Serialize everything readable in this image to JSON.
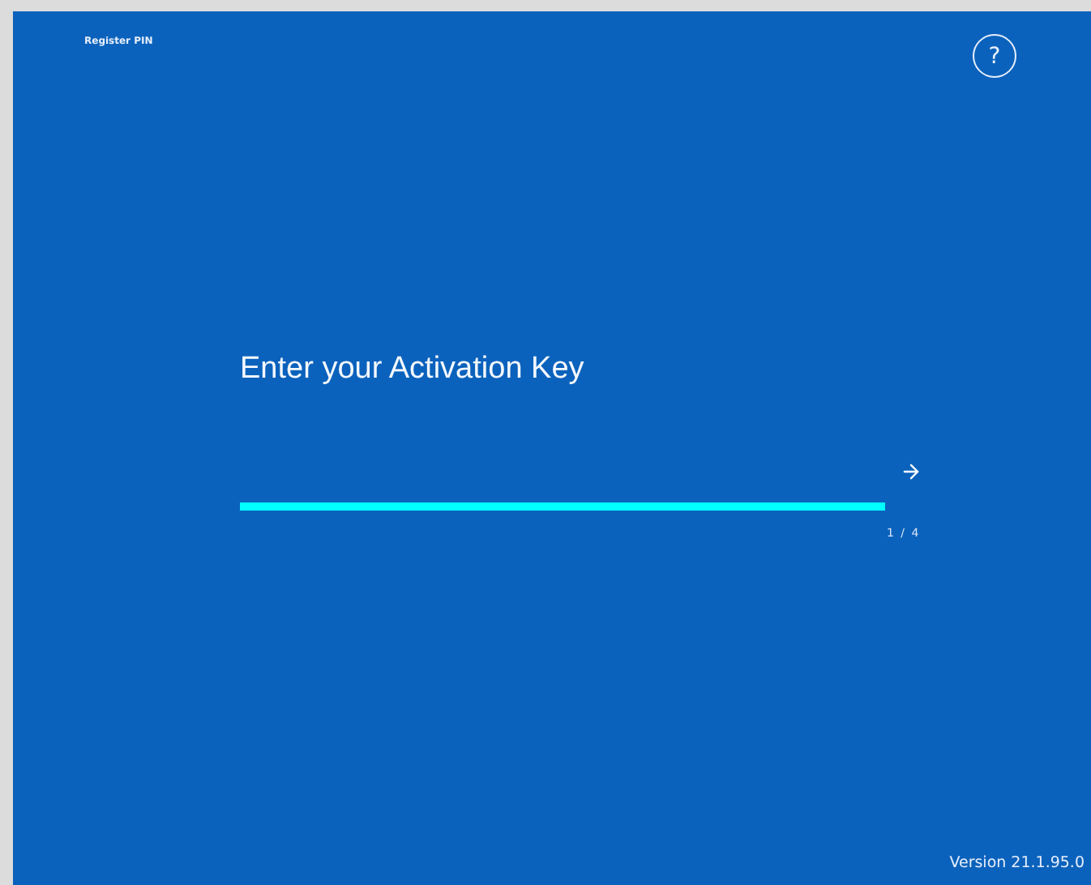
{
  "window": {
    "title": "Register PIN"
  },
  "help_button": {
    "label": "?"
  },
  "heading": "Enter your Activation Key",
  "step_counter": "1 / 4",
  "version": "Version 21.1.95.0"
}
